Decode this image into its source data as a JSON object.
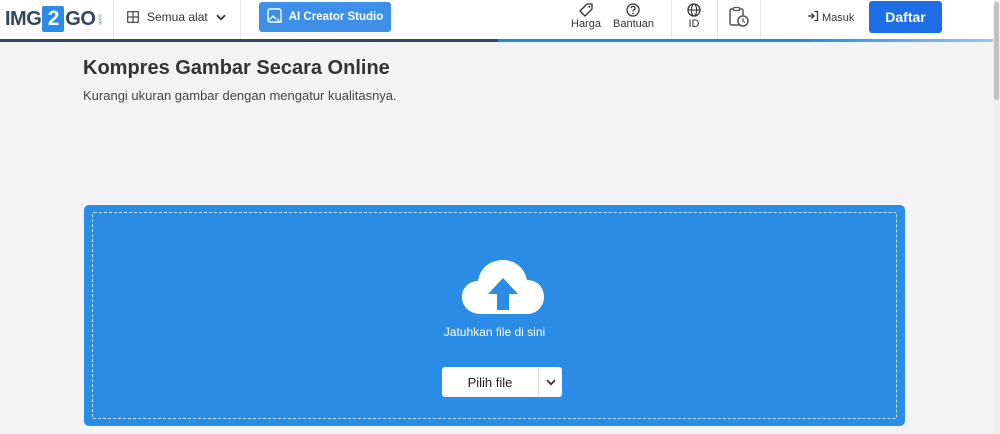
{
  "header": {
    "logo_left": "IMG",
    "logo_mid": "2",
    "logo_right": "GO",
    "logo_suffix": ".com",
    "all_tools_label": "Semua alat",
    "ai_button_label": "AI Creator Studio",
    "pricing_label": "Harga",
    "help_label": "Bantuan",
    "language_label": "ID",
    "login_label": "Masuk",
    "register_label": "Daftar",
    "accent_color": "#1d6ee6"
  },
  "main": {
    "title": "Kompres Gambar Secara Online",
    "subtitle": "Kurangi ukuran gambar dengan mengatur kualitasnya."
  },
  "upload": {
    "drop_text": "Jatuhkan file di sini",
    "choose_label": "Pilih file",
    "background_color": "#2b8ce6"
  }
}
